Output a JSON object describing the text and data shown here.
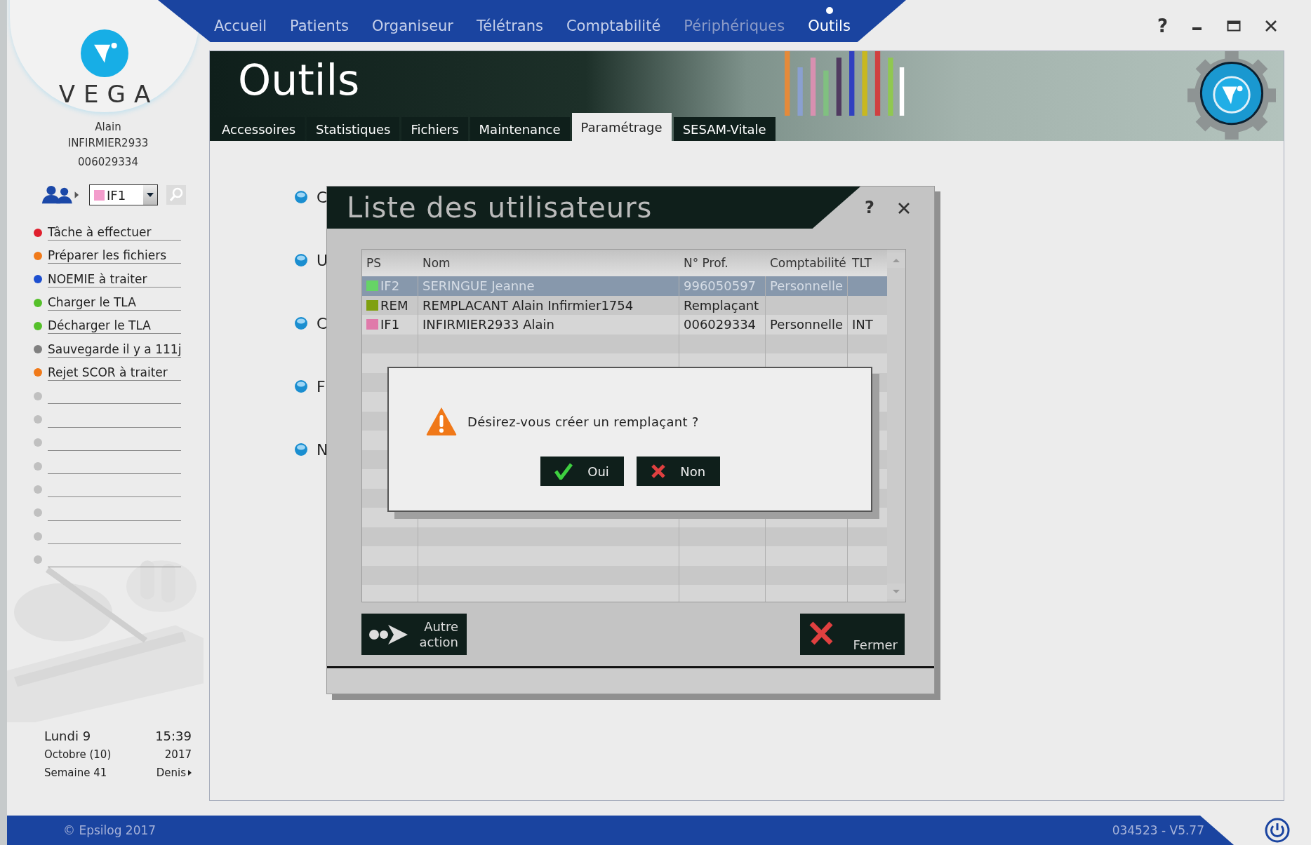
{
  "window": {
    "help": "?"
  },
  "logo": {
    "text": "VEGA"
  },
  "user": {
    "first_name": "Alain",
    "last_name": "INFIRMIER2933",
    "number": "006029334"
  },
  "user_select": {
    "value": "IF1",
    "color": "#f39ccc"
  },
  "tasks": [
    {
      "kind": "task",
      "label": "Tâche à effectuer",
      "color": "#e0202e"
    },
    {
      "kind": "task",
      "label": "Préparer les fichiers",
      "color": "#f07a1a"
    },
    {
      "kind": "task",
      "label": "NOEMIE à traiter",
      "color": "#1d4fd0"
    },
    {
      "kind": "task",
      "label": "Charger le TLA",
      "color": "#55c02a"
    },
    {
      "kind": "task",
      "label": "Décharger le TLA",
      "color": "#55c02a"
    },
    {
      "kind": "task",
      "label": "Sauvegarde il y a 111j",
      "color": "#808080"
    },
    {
      "kind": "task",
      "label": "Rejet SCOR à traiter",
      "color": "#f07a1a"
    },
    {
      "kind": "empty",
      "color": "#c0c0c0"
    },
    {
      "kind": "empty",
      "color": "#c0c0c0"
    },
    {
      "kind": "empty",
      "color": "#c0c0c0"
    },
    {
      "kind": "empty",
      "color": "#c0c0c0"
    },
    {
      "kind": "empty",
      "color": "#c0c0c0"
    },
    {
      "kind": "empty",
      "color": "#c0c0c0"
    },
    {
      "kind": "empty",
      "color": "#c0c0c0"
    },
    {
      "kind": "empty",
      "color": "#c0c0c0"
    }
  ],
  "date": {
    "day": "Lundi 9",
    "time": "15:39",
    "month": "Octobre (10)",
    "year": "2017",
    "week": "Semaine 41",
    "user": "Denis"
  },
  "nav": [
    {
      "label": "Accueil",
      "selected": false,
      "disabled": false
    },
    {
      "label": "Patients",
      "selected": false,
      "disabled": false
    },
    {
      "label": "Organiseur",
      "selected": false,
      "disabled": false
    },
    {
      "label": "Télétrans",
      "selected": false,
      "disabled": false
    },
    {
      "label": "Comptabilité",
      "selected": false,
      "disabled": false
    },
    {
      "label": "Périphériques",
      "selected": false,
      "disabled": true
    },
    {
      "label": "Outils",
      "selected": true,
      "disabled": false
    }
  ],
  "page": {
    "title": "Outils",
    "tabs": [
      {
        "label": "Accessoires",
        "selected": false
      },
      {
        "label": "Statistiques",
        "selected": false
      },
      {
        "label": "Fichiers",
        "selected": false
      },
      {
        "label": "Maintenance",
        "selected": false
      },
      {
        "label": "Paramétrage",
        "selected": true
      },
      {
        "label": "SESAM-Vitale",
        "selected": false
      }
    ],
    "items": [
      "C",
      "U",
      "C",
      "F",
      "N"
    ]
  },
  "dialog": {
    "title": "Liste des utilisateurs",
    "help": "?",
    "table": {
      "columns": [
        "PS",
        "Nom",
        "N° Prof.",
        "Comptabilité",
        "TLT"
      ],
      "rows": [
        {
          "ps": "IF2",
          "color": "#66d466",
          "name": "SERINGUE Jeanne",
          "number": "996050597",
          "accounting": "Personnelle",
          "selected": true
        },
        {
          "ps": "REM",
          "color": "#7fa010",
          "name": "REMPLACANT Alain Infirmier1754",
          "number": "Remplaçant",
          "selected": false
        },
        {
          "ps": "IF1",
          "color": "#e07aaa",
          "name": "INFIRMIER2933 Alain",
          "number": "006029334",
          "accounting": "Personnelle",
          "tlt": "INT",
          "selected": false
        }
      ]
    },
    "buttons": [
      {
        "kind": "other",
        "label": "Autre action"
      },
      {
        "kind": "close",
        "label": "Fermer"
      }
    ]
  },
  "confirm": {
    "message": "Désirez-vous créer un remplaçant ?",
    "buttons": [
      {
        "kind": "yes",
        "label": "Oui"
      },
      {
        "kind": "no",
        "label": "Non"
      }
    ]
  },
  "status_bar": {
    "copyright": "© Epsilog 2017",
    "version": "034523 - V5.77"
  }
}
